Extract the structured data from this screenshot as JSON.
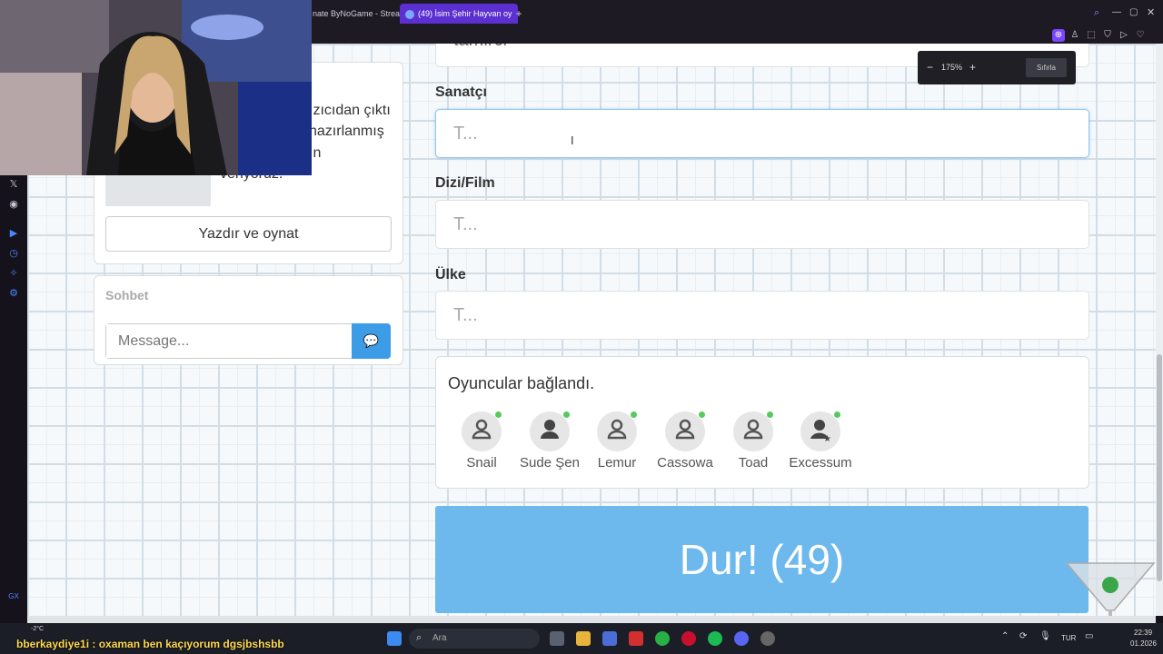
{
  "browser": {
    "tabs": [
      {
        "label": "nate ByNoGame - Strea",
        "active": false
      },
      {
        "label": "(49) İsim Şehir Hayvan oy",
        "active": true
      }
    ],
    "zoom": {
      "minus": "−",
      "value": "175%",
      "plus": "+",
      "reset_label": "Sıfırla"
    }
  },
  "left_panel": {
    "partial_text_1": "ızıcıdan çıktı",
    "partial_text_2": "hazırlanmış",
    "partial_text_3": "ın",
    "partial_text_4": "veriyoruz.",
    "print_button": "Yazdır ve oynat"
  },
  "chat": {
    "title": "Sohbet",
    "input_placeholder": "Message..."
  },
  "form": {
    "top_partial_value": "tamirci",
    "fields": [
      {
        "label": "Sanatçı",
        "placeholder": "T...",
        "focused": true
      },
      {
        "label": "Dizi/Film",
        "placeholder": "T...",
        "focused": false
      },
      {
        "label": "Ülke",
        "placeholder": "T...",
        "focused": false
      }
    ]
  },
  "players": {
    "title": "Oyuncular bağlandı.",
    "list": [
      "Snail",
      "Sude Şen",
      "Lemur",
      "Cassowa",
      "Toad",
      "Excessum"
    ]
  },
  "stop_button": "Dur! (49)",
  "stream_overlay": {
    "weather": "-2°C",
    "chat_line": "bberkaydiye1i : oxaman ben kaçıyorum dgsjbshsbb"
  },
  "taskbar": {
    "search": "Ara",
    "lang": "TUR",
    "time": "22:39",
    "date": "01.2026"
  },
  "colors": {
    "accent": "#6db8ec",
    "opera": "#7b46ff",
    "online": "#57c95f"
  }
}
